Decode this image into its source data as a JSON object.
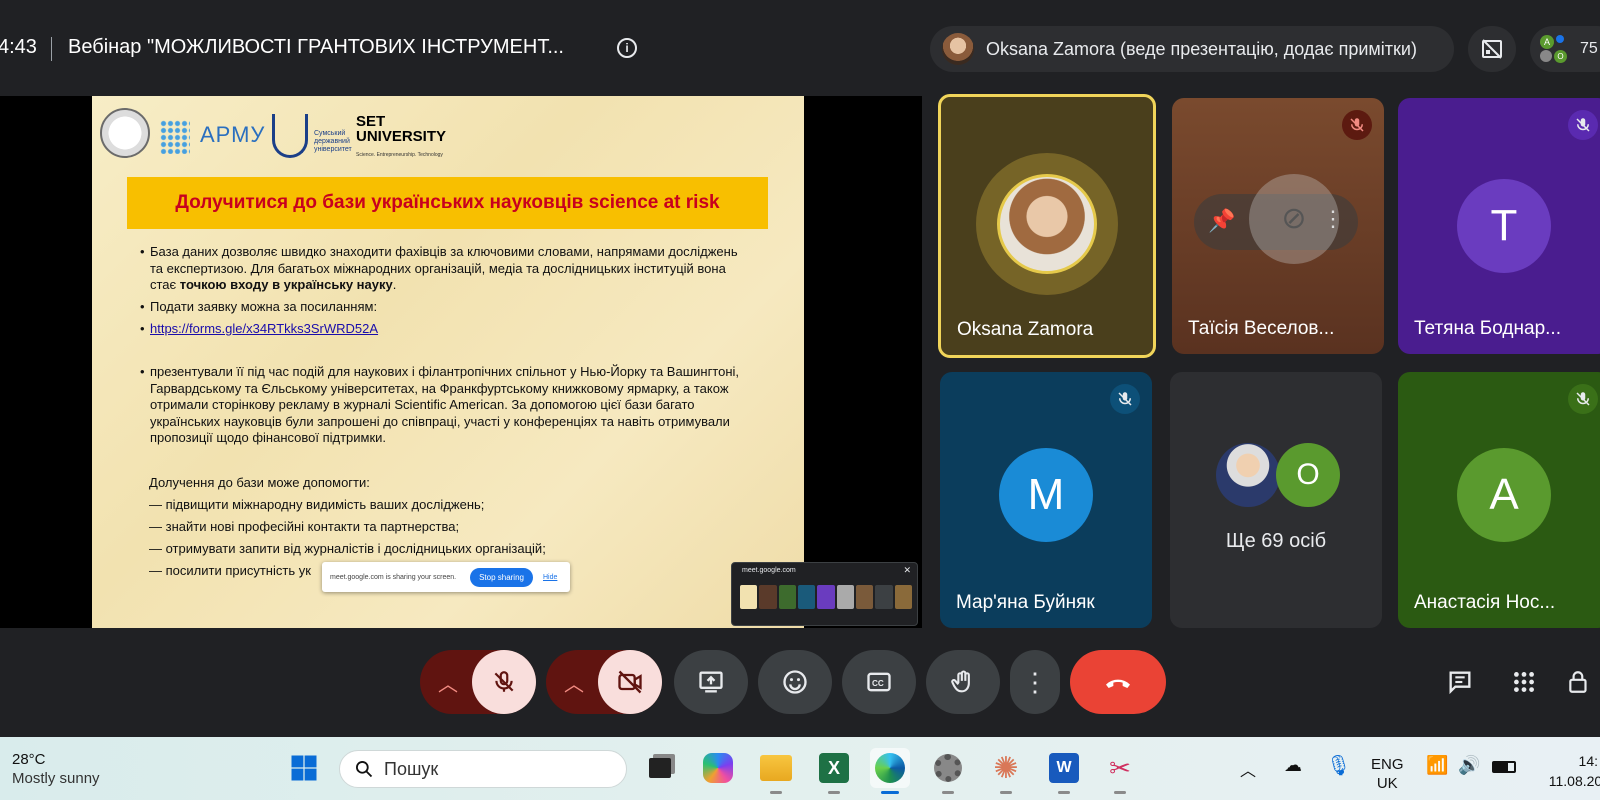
{
  "header": {
    "time": "4:43",
    "meeting_title": "Вебінар \"МОЖЛИВОСТІ ГРАНТОВИХ ІНСТРУМЕНТ...",
    "presenter_label": "Oksana Zamora (веде презентацію, додає примітки)",
    "participant_count": "75"
  },
  "slide": {
    "logos": {
      "armu": "АРМУ",
      "set_line1": "SET",
      "set_line2": "UNIVERSITY",
      "set_tagline": "Science. Entrepreneurship. Technology",
      "sumy": "Сумський державний університет"
    },
    "banner": "Долучитися до бази українських науковців science at risk",
    "bullet1_pre": "База даних дозволяє швидко знаходити фахівців за ключовими словами, напрямами досліджень та експертизою. Для багатьох міжнародних організацій, медіа та дослідницьких інституцій вона стає ",
    "bullet1_bold": "точкою входу в українську науку",
    "bullet1_post": ".",
    "bullet2": "Подати заявку можна за посиланням:",
    "bullet3_link": "https://forms.gle/x34RTkks3SrWRD52A",
    "bullet4": "презентували її під час подій для наукових і філантропічних спільнот у Нью-Йорку та Вашингтоні, Гарвардському та Єльському університетах, на Франкфуртському книжковому ярмарку, а також отримали сторінкову рекламу в журналі Scientific American. За допомогою цієї бази багато українських науковців були запрошені до співпраці, участі у конференціях та навіть отримували пропозиції щодо фінансової підтримки.",
    "benefits_title": "Долучення до бази може допомогти:",
    "benefits": [
      "— підвищити міжнародну видимість ваших досліджень;",
      "— знайти нові професійні контакти та партнерства;",
      "— отримувати запити від журналістів і дослідницьких організацій;",
      "— посилити присутність ук"
    ]
  },
  "share_notice": {
    "text": "meet.google.com is sharing your screen.",
    "stop": "Stop sharing",
    "hide": "Hide"
  },
  "pip": {
    "title": "meet.google.com"
  },
  "participants": [
    {
      "name": "Oksana Zamora",
      "initial": "",
      "color": "#4a3f1c"
    },
    {
      "name": "Таїсія Веселов...",
      "initial": "",
      "color": "#6b3a24"
    },
    {
      "name": "Тетяна Боднар...",
      "initial": "T",
      "color": "#4a1d8f"
    },
    {
      "name": "Мар'яна Буйняк",
      "initial": "M",
      "color": "#0b3d5c"
    },
    {
      "name": "Ще 69 осіб",
      "initial": "O",
      "color": "#2d2e31"
    },
    {
      "name": "Анастасія Нос...",
      "initial": "A",
      "color": "#2b5a12"
    }
  ],
  "colors": {
    "end_call": "#ea4335",
    "muted_bg": "#f9dedc",
    "muted_side": "#601410",
    "speaker_border": "#f1d55a",
    "avatar_green": "#5a9a2e",
    "avatar_blue": "#1a8bd6",
    "avatar_purple": "#6a3cbf"
  },
  "taskbar": {
    "weather_temp": "28°C",
    "weather_desc": "Mostly sunny",
    "search_placeholder": "Пошук",
    "lang_line1": "ENG",
    "lang_line2": "UK",
    "clock_time": "14:",
    "clock_date": "11.08.202"
  }
}
